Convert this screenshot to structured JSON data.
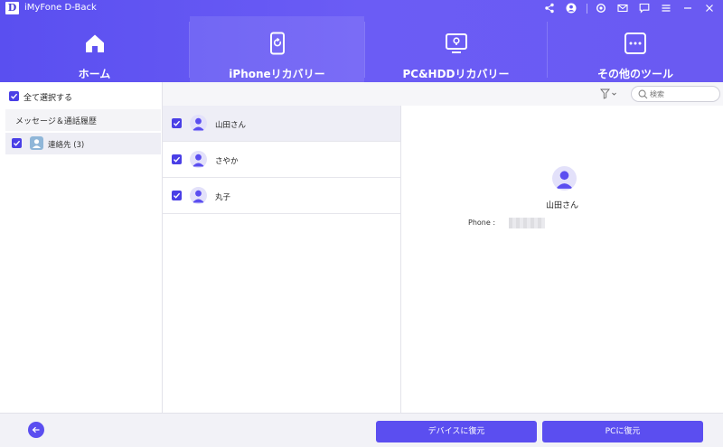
{
  "app": {
    "title": "iMyFone D-Back",
    "logo_letter": "D"
  },
  "titlebar_icons": [
    "share-icon",
    "user-icon",
    "settings-icon",
    "mail-icon",
    "chat-icon",
    "menu-icon",
    "minimize-icon",
    "close-icon"
  ],
  "nav": {
    "active_tab": "iPhoneリカバリー",
    "tabs": [
      {
        "label": "ホーム",
        "icon": "home-icon"
      },
      {
        "label": "iPhoneリカバリー",
        "icon": "phone-recovery-icon"
      },
      {
        "label": "PC&HDDリカバリー",
        "icon": "monitor-icon"
      },
      {
        "label": "その他のツール",
        "icon": "more-tools-icon"
      }
    ]
  },
  "sidebar": {
    "select_all_label": "全て選択する",
    "select_all_checked": true,
    "category_header": "メッセージ＆通話履歴",
    "items": [
      {
        "label": "連絡先 (3)",
        "checked": true,
        "icon": "contacts-icon"
      }
    ]
  },
  "toolbar": {
    "search_placeholder": "検索",
    "filter_icon": "filter-icon",
    "search_icon": "search-icon"
  },
  "contacts": [
    {
      "name": "山田さん",
      "checked": true,
      "selected": true
    },
    {
      "name": "さやか",
      "checked": true,
      "selected": false
    },
    {
      "name": "丸子",
      "checked": true,
      "selected": false
    }
  ],
  "detail": {
    "name": "山田さん",
    "phone_label": "Phone :"
  },
  "footer": {
    "restore_device_label": "デバイスに復元",
    "restore_pc_label": "PCに復元",
    "back_icon": "back-arrow-icon"
  },
  "colors": {
    "accent": "#5b4ef0",
    "header": "#6358f2",
    "selected_row": "#eeeef6"
  }
}
